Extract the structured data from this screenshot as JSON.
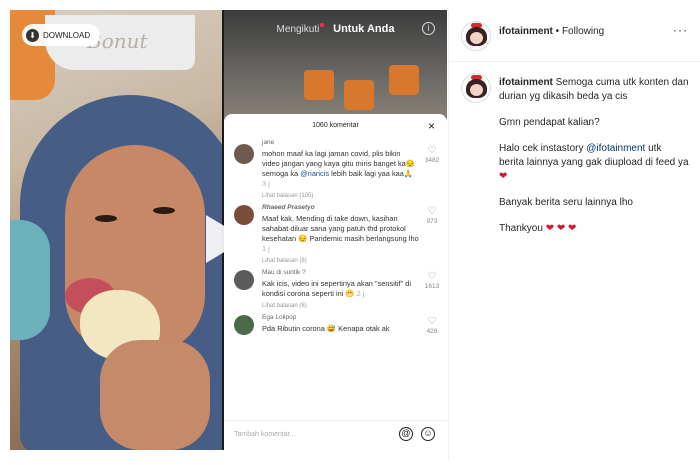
{
  "download": {
    "label": "DOWNLOAD"
  },
  "left_video": {
    "sign_text": "Bonut"
  },
  "tiktok": {
    "tab_following": "Mengikuti",
    "tab_foryou": "Untuk Anda",
    "info_icon": "i",
    "comments_count": "1060 komentar",
    "close": "×",
    "comments": [
      {
        "user": "jane",
        "text_a": "mohon maaf ka lagi jaman covid, plis bikin video jangan yang kaya gitu miris banget ka😔 semoga ka ",
        "mention": "@riaricis",
        "text_b": " lebih baik lagi yaa kaa🙏",
        "time": " 3 j",
        "likes": "3482",
        "replies": "Lihat balasan (105)"
      },
      {
        "user": "Rhaeed Prasetyo",
        "text_a": "Maaf kak. Mending di take down, kasihan sahabat diluar sana yang patuh thd protokol kesehatan 😔 Pandemic masih berlangsung lho",
        "time": " 1 j",
        "likes": "973",
        "replies": "Lihat balasan (8)"
      },
      {
        "user": "Mau di suntik ?",
        "text_a": "Kak icis, video ini sepertinya akan \"sensitif\" di kondisi corona seperti ini 😬",
        "time": " 2 j",
        "likes": "1613",
        "replies": "Lihat balasan (8)"
      },
      {
        "user": "Ega Lolipop",
        "text_a": "Pda Ributin corona 😅 Kenapa otak ak",
        "likes": "428"
      }
    ],
    "input_placeholder": "Tambah komentar...",
    "at_icon": "@",
    "emoji_icon": "☺"
  },
  "instagram": {
    "username": "ifotainment",
    "follow_status": "• Following",
    "more": "···",
    "caption": {
      "username": "ifotainment",
      "line1": "Semoga cuma utk konten dan durian yg dikasih beda ya cis",
      "line2": "Gmn pendapat kalian?",
      "line3_a": "Halo cek instastory ",
      "line3_mention": "@ifotainment",
      "line3_b": " utk berita lainnya yang gak diupload di feed ya ",
      "line4": "Banyak berita seru lainnya lho",
      "line5": "Thankyou "
    },
    "hearts_one": "❤",
    "hearts_three": "❤ ❤ ❤"
  }
}
